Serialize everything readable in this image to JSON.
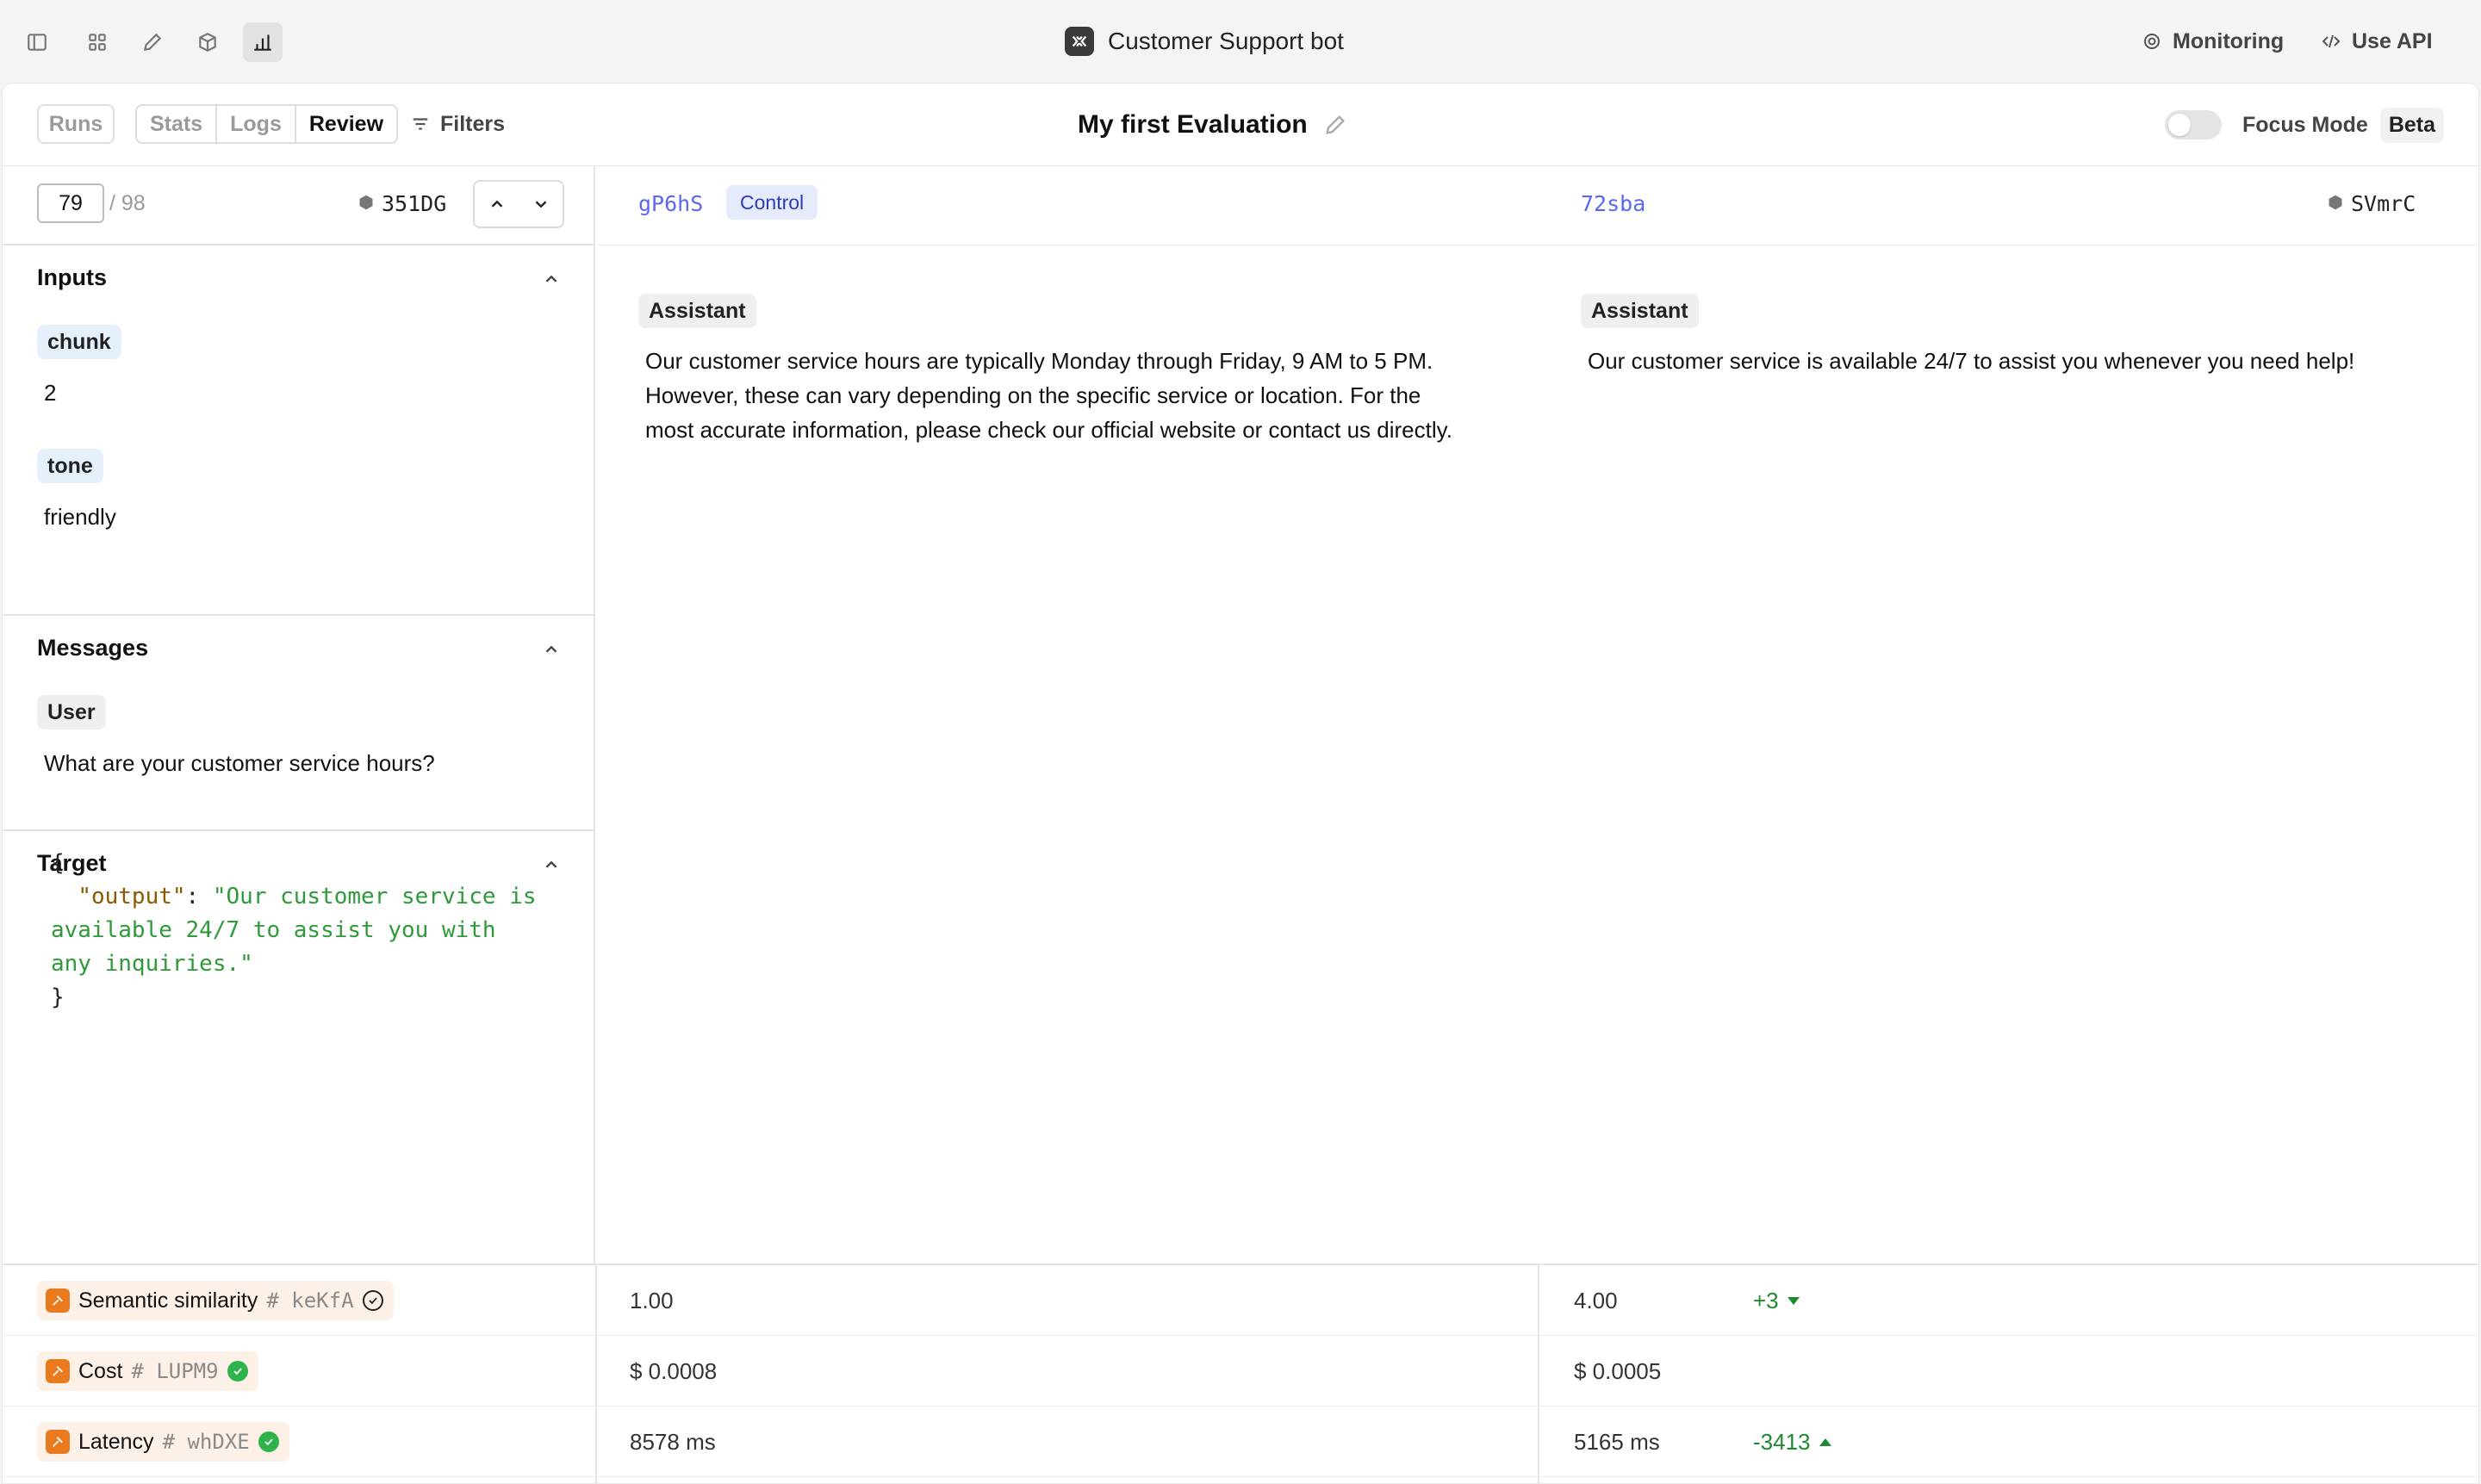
{
  "app": {
    "title": "Customer Support bot"
  },
  "topbar": {
    "icons": [
      "sidebar-toggle-icon",
      "grid-icon",
      "pencil-icon",
      "cube-icon",
      "chart-icon"
    ],
    "monitoring_label": "Monitoring",
    "use_api_label": "Use API"
  },
  "toolbar": {
    "runs_label": "Runs",
    "tabs": [
      {
        "label": "Stats"
      },
      {
        "label": "Logs"
      },
      {
        "label": "Review"
      }
    ],
    "active_tab": "Review",
    "filters_label": "Filters",
    "evaluation_title": "My first Evaluation",
    "focus_mode_label": "Focus Mode",
    "focus_mode_enabled": false,
    "beta_label": "Beta"
  },
  "navigator": {
    "current_page": "79",
    "total": "/ 98",
    "row_id": "351DG"
  },
  "inputs": {
    "title": "Inputs",
    "fields": [
      {
        "name": "chunk",
        "value": "2"
      },
      {
        "name": "tone",
        "value": "friendly"
      }
    ]
  },
  "messages": {
    "title": "Messages",
    "items": [
      {
        "role": "User",
        "content": "What are your customer service hours?"
      }
    ]
  },
  "target": {
    "title": "Target",
    "open": "{",
    "key": "\"output\"",
    "value_lines": [
      "\"Our customer service is",
      "available 24/7 to assist you with",
      "any inquiries.\""
    ],
    "close": "}"
  },
  "runs": [
    {
      "id": "gP6hS",
      "badge": "Control",
      "role": "Assistant",
      "answer_lines": [
        "Our customer service hours are typically Monday through Friday, 9 AM to 5 PM.",
        "However, these can vary depending on the specific service or location. For the",
        "most accurate information, please check our official website or contact us directly."
      ]
    },
    {
      "id": "72sba",
      "row_id": "SVmrC",
      "role": "Assistant",
      "answer_lines": [
        "Our customer service is available 24/7 to assist you whenever you need help!"
      ]
    }
  ],
  "metrics": [
    {
      "name": "Semantic similarity",
      "id": "keKfA",
      "status": "outline-check",
      "control": "1.00",
      "comparison": "4.00",
      "diff": "+3",
      "diff_direction": "down"
    },
    {
      "name": "Cost",
      "id": "LUPM9",
      "status": "green-check",
      "control": "$ 0.0008",
      "comparison": "$ 0.0005",
      "diff": "",
      "diff_direction": ""
    },
    {
      "name": "Latency",
      "id": "whDXE",
      "status": "green-check",
      "control": "8578 ms",
      "comparison": "5165 ms",
      "diff": "-3413",
      "diff_direction": "up"
    }
  ],
  "colors": {
    "accent_link": "#5b67f0",
    "scorer_orange": "#ea7a1e",
    "positive_green": "#1e8a2f",
    "check_green": "#2fb24b"
  }
}
